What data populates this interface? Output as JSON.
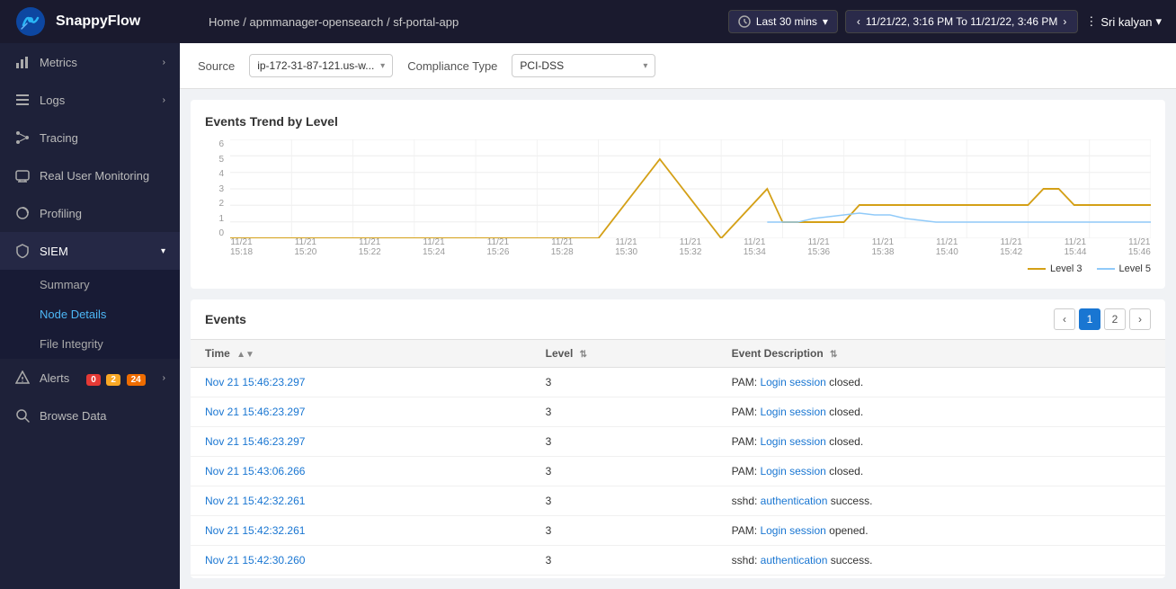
{
  "header": {
    "logo_text": "SnappyFlow",
    "breadcrumb": "Home / apmmanager-opensearch / sf-portal-app",
    "time_picker_label": "Last 30 mins",
    "date_range": "11/21/22, 3:16 PM To 11/21/22, 3:46 PM",
    "user_label": "Sri kalyan"
  },
  "sidebar": {
    "items": [
      {
        "id": "metrics",
        "label": "Metrics",
        "icon": "chart-icon",
        "has_chevron": true
      },
      {
        "id": "logs",
        "label": "Logs",
        "icon": "list-icon",
        "has_chevron": true
      },
      {
        "id": "tracing",
        "label": "Tracing",
        "icon": "tracing-icon",
        "has_chevron": false
      },
      {
        "id": "rum",
        "label": "Real User Monitoring",
        "icon": "rum-icon",
        "has_chevron": false
      },
      {
        "id": "profiling",
        "label": "Profiling",
        "icon": "profiling-icon",
        "has_chevron": false
      },
      {
        "id": "siem",
        "label": "SIEM",
        "icon": "siem-icon",
        "has_chevron": true,
        "expanded": true
      },
      {
        "id": "alerts",
        "label": "Alerts",
        "icon": "alert-icon",
        "badges": [
          {
            "color": "red",
            "count": "0"
          },
          {
            "color": "yellow",
            "count": "2"
          },
          {
            "color": "orange",
            "count": "24"
          }
        ]
      },
      {
        "id": "browse-data",
        "label": "Browse Data",
        "icon": "browse-icon",
        "has_chevron": false
      }
    ],
    "siem_sub_items": [
      {
        "id": "summary",
        "label": "Summary"
      },
      {
        "id": "node-details",
        "label": "Node Details"
      },
      {
        "id": "file-integrity",
        "label": "File Integrity"
      }
    ]
  },
  "filters": {
    "source_label": "Source",
    "source_value": "ip-172-31-87-121.us-w...",
    "compliance_label": "Compliance Type",
    "compliance_value": "PCI-DSS"
  },
  "chart": {
    "title": "Events Trend by Level",
    "y_axis_labels": [
      "6",
      "5",
      "4",
      "3",
      "2",
      "1",
      "0"
    ],
    "x_axis_labels": [
      "11/21\n15:18",
      "11/21\n15:20",
      "11/21\n15:22",
      "11/21\n15:24",
      "11/21\n15:26",
      "11/21\n15:28",
      "11/21\n15:30",
      "11/21\n15:32",
      "11/21\n15:34",
      "11/21\n15:36",
      "11/21\n15:38",
      "11/21\n15:40",
      "11/21\n15:42",
      "11/21\n15:44",
      "11/21\n15:46"
    ],
    "legend": [
      {
        "label": "Level 3",
        "color": "#d4a017"
      },
      {
        "label": "Level 5",
        "color": "#90caf9"
      }
    ]
  },
  "events": {
    "title": "Events",
    "columns": [
      "Time",
      "Level",
      "Event Description"
    ],
    "pagination": {
      "prev": "<",
      "page1": "1",
      "page2": "2",
      "next": ">"
    },
    "rows": [
      {
        "time": "Nov 21 15:46:23.297",
        "level": "3",
        "description": "PAM: Login session closed.",
        "desc_parts": [
          "PAM: ",
          "Login session",
          " closed."
        ]
      },
      {
        "time": "Nov 21 15:46:23.297",
        "level": "3",
        "description": "PAM: Login session closed.",
        "desc_parts": [
          "PAM: ",
          "Login session",
          " closed."
        ]
      },
      {
        "time": "Nov 21 15:46:23.297",
        "level": "3",
        "description": "PAM: Login session closed.",
        "desc_parts": [
          "PAM: ",
          "Login session",
          " closed."
        ]
      },
      {
        "time": "Nov 21 15:43:06.266",
        "level": "3",
        "description": "PAM: Login session closed.",
        "desc_parts": [
          "PAM: ",
          "Login session",
          " closed."
        ]
      },
      {
        "time": "Nov 21 15:42:32.261",
        "level": "3",
        "description": "sshd: authentication success.",
        "desc_parts": [
          "sshd: ",
          "authentication",
          " success."
        ]
      },
      {
        "time": "Nov 21 15:42:32.261",
        "level": "3",
        "description": "PAM: Login session opened.",
        "desc_parts": [
          "PAM: ",
          "Login session",
          " opened."
        ]
      },
      {
        "time": "Nov 21 15:42:30.260",
        "level": "3",
        "description": "sshd: authentication success.",
        "desc_parts": [
          "sshd: ",
          "authentication",
          " success."
        ]
      }
    ]
  }
}
